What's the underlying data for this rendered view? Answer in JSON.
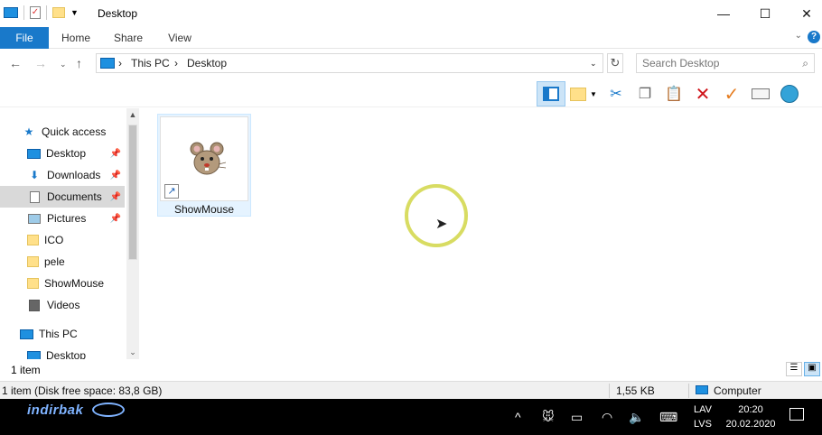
{
  "window": {
    "title": "Desktop",
    "minimize": "—",
    "maximize": "☐",
    "close": "✕"
  },
  "ribbon": {
    "tabs": [
      "File",
      "Home",
      "Share",
      "View"
    ],
    "help": "?",
    "collapse": "⌄"
  },
  "address": {
    "crumbs": [
      "This PC",
      "Desktop"
    ],
    "separator": "›",
    "search_placeholder": "Search Desktop"
  },
  "nav": {
    "quick_access": "Quick access",
    "items": [
      {
        "label": "Desktop",
        "icon": "desktop-icon",
        "pinned": true
      },
      {
        "label": "Downloads",
        "icon": "download-icon",
        "pinned": true
      },
      {
        "label": "Documents",
        "icon": "document-icon",
        "pinned": true,
        "selected": true
      },
      {
        "label": "Pictures",
        "icon": "picture-icon",
        "pinned": true
      },
      {
        "label": "ICO",
        "icon": "folder-icon"
      },
      {
        "label": "pele",
        "icon": "folder-icon"
      },
      {
        "label": "ShowMouse",
        "icon": "folder-icon"
      },
      {
        "label": "Videos",
        "icon": "video-icon"
      }
    ],
    "this_pc": "This PC",
    "this_pc_child": "Desktop"
  },
  "content": {
    "files": [
      {
        "name": "ShowMouse",
        "icon": "mouse-shortcut-icon"
      }
    ]
  },
  "status": {
    "count": "1 item",
    "free_space": "1 item (Disk free space: 83,8 GB)",
    "size": "1,55 KB",
    "location": "Computer"
  },
  "taskbar": {
    "logo": "indirbak",
    "lang_line1": "LAV",
    "lang_line2": "LVS",
    "time": "20:20",
    "date": "20.02.2020"
  },
  "colors": {
    "accent": "#1979ca",
    "selection": "#cce4f7",
    "cursor_ring": "#d8dc62"
  }
}
